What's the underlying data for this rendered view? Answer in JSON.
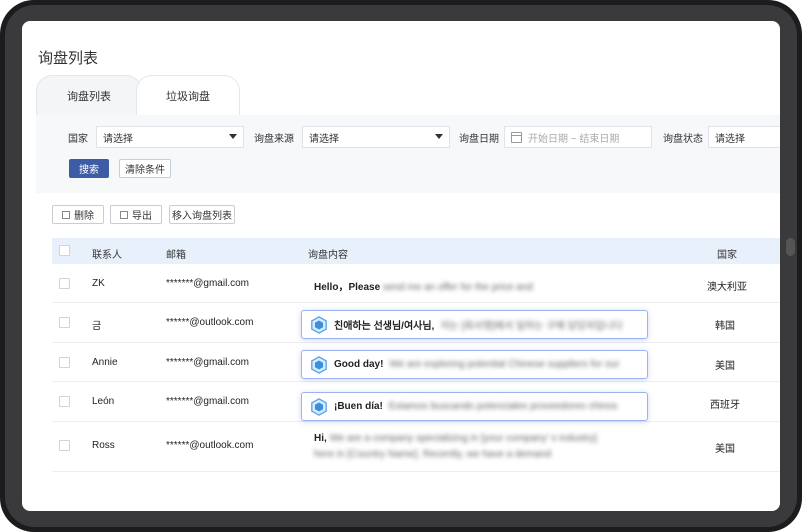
{
  "page": {
    "title": "询盘列表"
  },
  "tabs": [
    {
      "label": "询盘列表"
    },
    {
      "label": "垃圾询盘"
    }
  ],
  "filters": {
    "country": {
      "label": "国家",
      "value": "请选择"
    },
    "source": {
      "label": "询盘来源",
      "value": "请选择"
    },
    "date": {
      "label": "询盘日期",
      "placeholder": "开始日期 ~ 结束日期"
    },
    "status": {
      "label": "询盘状态",
      "value": "请选择"
    },
    "search_label": "搜索",
    "clear_label": "清除条件"
  },
  "actions": {
    "delete_label": "删除",
    "export_label": "导出",
    "move_label": "移入询盘列表"
  },
  "table": {
    "headers": {
      "contact": "联系人",
      "email": "邮箱",
      "content": "询盘内容",
      "country": "国家"
    },
    "rows": [
      {
        "contact": "ZK",
        "email": "*******@gmail.com",
        "msg_bold": "Hello，Please",
        "msg_rest": "send me an offer for the price and",
        "country": "澳大利亚"
      },
      {
        "contact": "금",
        "email": "******@outlook.com",
        "msg_bold": "친애하는 선생님/여사님,",
        "msg_rest": "저는 [회사명]에서 일하는 구매 담당자입니다",
        "country": "韩国"
      },
      {
        "contact": "Annie",
        "email": "*******@gmail.com",
        "msg_bold": "Good day!",
        "msg_rest": "We are exploring potential Chinese suppliers for our",
        "country": "美国"
      },
      {
        "contact": "León",
        "email": "*******@gmail.com",
        "msg_bold": "¡Buen día!",
        "msg_rest": "Estamos buscando potenciales proveedores chinos",
        "country": "西班牙"
      },
      {
        "contact": "Ross",
        "email": "******@outlook.com",
        "msg_bold": "Hi,",
        "msg_rest": "We are a company specializing in [your company' s industry]",
        "msg_rest2": "here in [Country Name]. Recently, we have a demand",
        "country": "美国"
      }
    ]
  },
  "icons": {
    "ai_badge": "ai-translate-icon",
    "calendar": "calendar-icon"
  },
  "colors": {
    "primary": "#3e5ba5",
    "header_bg": "#e8f0fb",
    "bubble_border": "#9db2f0"
  }
}
